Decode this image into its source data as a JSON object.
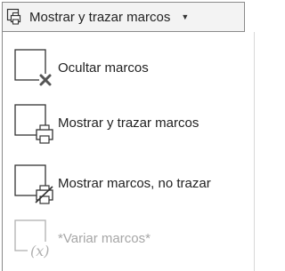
{
  "dropdown": {
    "label": "Mostrar y trazar marcos",
    "icon": "printer-frame-icon",
    "caret_icon": "chevron-down-icon"
  },
  "menu": {
    "items": [
      {
        "label": "Ocultar marcos",
        "icon": "frame-hide-icon",
        "enabled": true
      },
      {
        "label": "Mostrar y trazar marcos",
        "icon": "frame-print-icon",
        "enabled": true
      },
      {
        "label": "Mostrar marcos, no trazar",
        "icon": "frame-no-print-icon",
        "enabled": true
      },
      {
        "label": "*Variar marcos*",
        "icon": "frame-variable-icon",
        "enabled": false
      }
    ]
  },
  "colors": {
    "frame_stroke": "#333333",
    "disabled": "#b0b0b0",
    "button_bg": "#f3f3f3"
  }
}
